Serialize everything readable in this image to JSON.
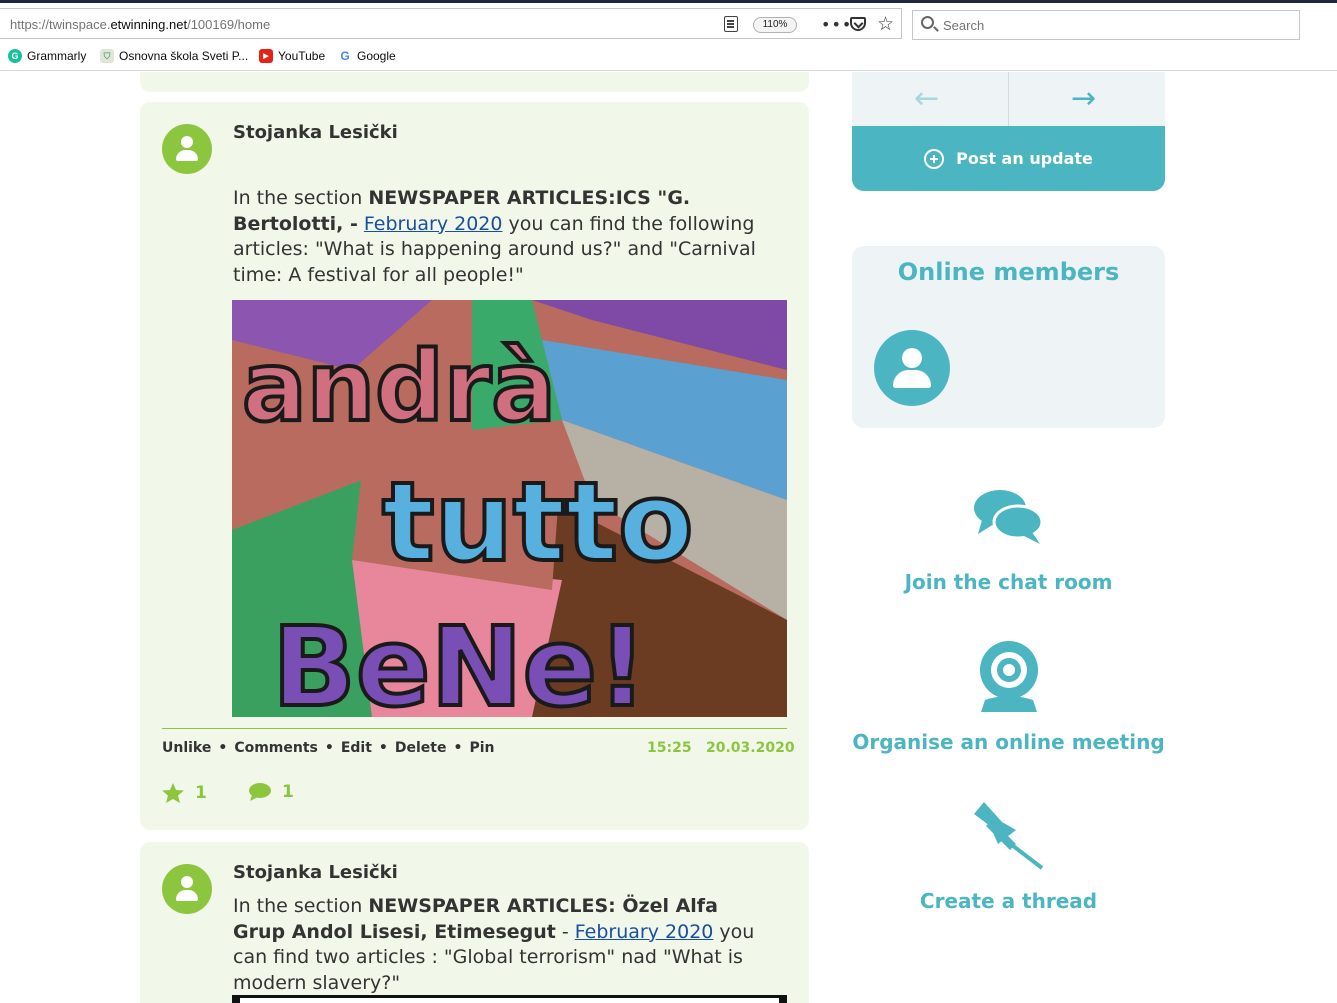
{
  "browser": {
    "url_prefix": "https://twinspace.",
    "url_domain": "etwinning.net",
    "url_path": "/100169/home",
    "zoom": "110%",
    "more": "•••",
    "star": "☆",
    "search_placeholder": "Search",
    "bookmarks": [
      {
        "label": "Grammarly",
        "icon": "grammarly-icon",
        "color": "#15c39a",
        "glyph": "G"
      },
      {
        "label": "Osnovna škola Sveti P...",
        "icon": "shield-icon",
        "color": "#9aa",
        "glyph": "⛉"
      },
      {
        "label": "YouTube",
        "icon": "youtube-icon",
        "color": "#e62117",
        "glyph": "▶"
      },
      {
        "label": "Google",
        "icon": "google-icon",
        "color": "#4285f4",
        "glyph": "G"
      }
    ]
  },
  "posts": [
    {
      "author": "Stojanka Lesički",
      "text_prefix": "In the section ",
      "text_bold": "NEWSPAPER ARTICLES:ICS \"G. Bertolotti, -",
      "text_link": "February 2020",
      "text_suffix": " you can find the following articles:  \"What is happening around us?\" and \"Carnival time: A festival for all people!\"",
      "image_alt": "Andrà tutto bene!",
      "actions": [
        "Unlike",
        "Comments",
        "Edit",
        "Delete",
        "Pin"
      ],
      "action_sep": "•",
      "time": "15:25",
      "date": "20.03.2020",
      "likes": "1",
      "comments": "1"
    },
    {
      "author": "Stojanka Lesički",
      "text_prefix": "In the section ",
      "text_bold": "NEWSPAPER ARTICLES: Özel Alfa Grup Andol Lisesi, Etimesegut",
      "text_dash": " - ",
      "text_link": "February 2020",
      "text_suffix": " you can find two  articles : \"Global terrorism\" nad \"What is modern slavery?\""
    }
  ],
  "sidebar": {
    "prev_arrow": "←",
    "next_arrow": "→",
    "post_update": "Post an update",
    "online_members_title": "Online members",
    "tools": [
      {
        "label": "Join the chat room",
        "icon": "chat-icon"
      },
      {
        "label": "Organise an online meeting",
        "icon": "webcam-icon"
      },
      {
        "label": "Create a thread",
        "icon": "pushpin-icon"
      }
    ]
  },
  "colors": {
    "green": "#8cc63f",
    "teal": "#4bb5c1",
    "card_bg": "#f1f8e9"
  }
}
